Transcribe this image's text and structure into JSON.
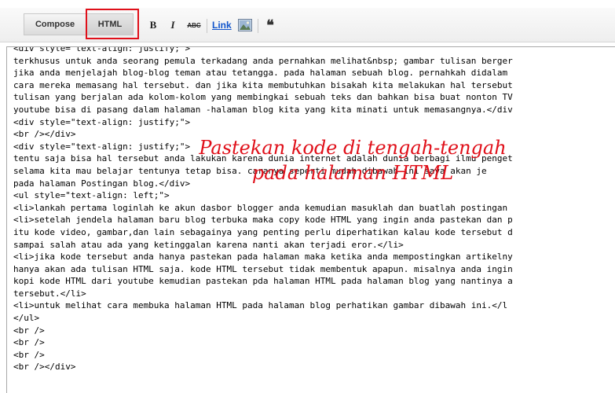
{
  "toolbar": {
    "compose_label": "Compose",
    "html_label": "HTML",
    "bold_label": "B",
    "italic_label": "I",
    "strike_label": "ABC",
    "link_label": "Link",
    "quote_label": "❝",
    "highlight_color": "#e0101a"
  },
  "editor": {
    "lines": [
      "<div style=\"text-align: justify;\">",
      "terkhusus untuk anda seorang pemula terkadang anda pernahkan melihat&nbsp; gambar tulisan berger",
      "jika anda menjelajah blog-blog teman atau tetangga. pada halaman sebuah blog. pernahkah didalam",
      "cara mereka memasang hal tersebut. dan jika kita membutuhkan bisakah kita melakukan hal tersebut",
      "tulisan yang berjalan ada kolom-kolom yang membingkai sebuah teks dan bahkan bisa buat nonton TV",
      "youtube bisa di pasang dalam halaman -halaman blog kita yang kita minati untuk memasangnya.</div",
      "<div style=\"text-align: justify;\">",
      "<br /></div>",
      "<div style=\"text-align: justify;\">",
      "tentu saja bisa hal tersebut anda lakukan karena dunia internet adalah dunia berbagi ilmu penget",
      "selama kita mau belajar tentunya tetap bisa. caranya seperti mudah dibawah ini saya akan je",
      "pada halaman Postingan blog.</div>",
      "<ul style=\"text-align: left;\">",
      "<li>lankah pertama loginlah ke akun dasbor blogger anda kemudian masuklah dan buatlah postingan",
      "<li>setelah jendela halaman baru blog terbuka maka copy kode HTML yang ingin anda pastekan dan p",
      "itu kode video, gambar,dan lain sebagainya yang penting perlu diperhatikan kalau kode tersebut d",
      "sampai salah atau ada yang ketinggalan karena nanti akan terjadi eror.</li>",
      "<li>jika kode tersebut anda hanya pastekan pada halaman maka ketika anda mempostingkan artikelny",
      "hanya akan ada tulisan HTML saja. kode HTML tersebut tidak membentuk apapun. misalnya anda ingin",
      "kopi kode HTML dari youtube kemudian pastekan pda halaman HTML pada halaman blog yang nantinya a",
      "tersebut.</li>",
      "<li>untuk melihat cara membuka halaman HTML pada halaman blog perhatikan gambar dibawah ini.</l",
      "</ul>",
      "<br />",
      "<br />",
      "<br />",
      "<br /></div>"
    ]
  },
  "annotation": {
    "line1": "Pastekan kode di tengah-tengah",
    "line2": "pada halaman HTML",
    "color": "#e0101a"
  }
}
